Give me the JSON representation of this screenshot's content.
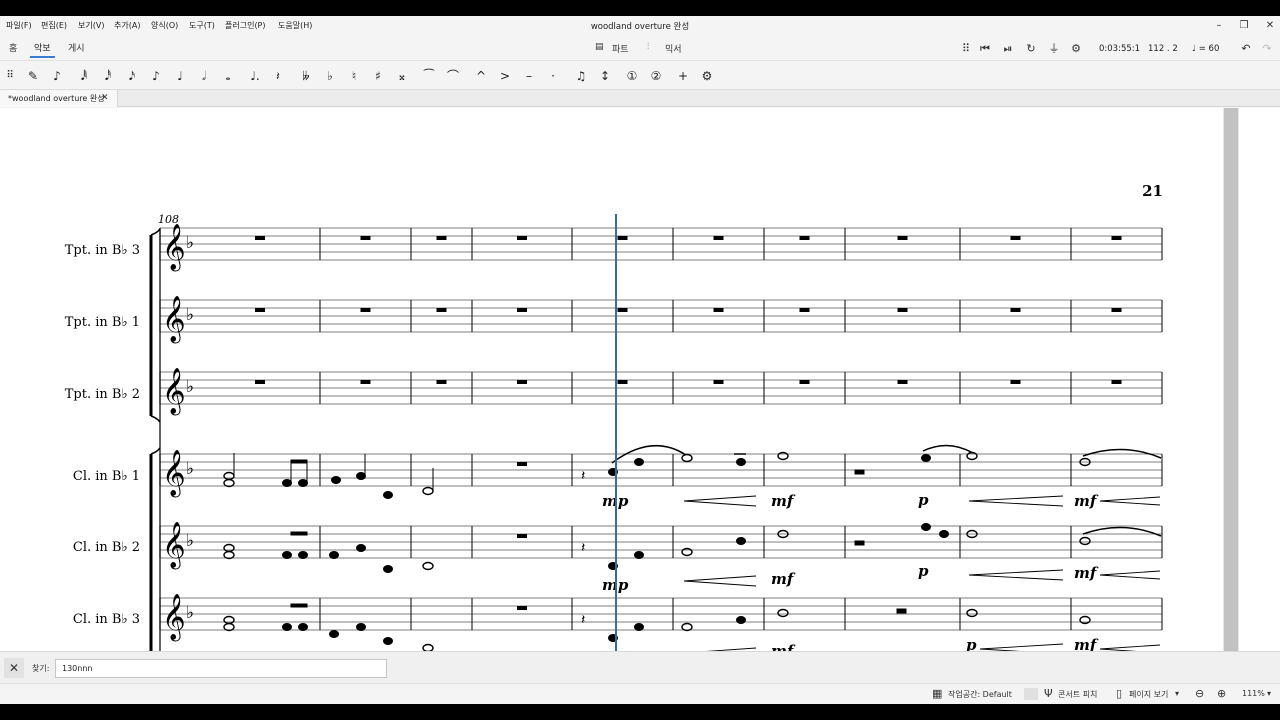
{
  "window": {
    "title": "woodland overture 완성"
  },
  "menu": [
    "파일(F)",
    "편집(E)",
    "보기(V)",
    "추가(A)",
    "양식(O)",
    "도구(T)",
    "플러그인(P)",
    "도움말(H)"
  ],
  "top_tabs": {
    "home": "홈",
    "score": "악보",
    "publish": "게시"
  },
  "center_tabs": {
    "parts": "파트",
    "mixer": "믹서"
  },
  "playback": {
    "time": "0:03:55:1",
    "position": "112 . 2",
    "tempo": "♩ = 60"
  },
  "document_tab": {
    "name": "*woodland overture 완성"
  },
  "score": {
    "page_number": "21",
    "measure_number": "108",
    "instruments": [
      "Tpt. in B♭ 3",
      "Tpt. in B♭ 1",
      "Tpt. in B♭ 2",
      "Cl. in B♭ 1",
      "Cl. in B♭ 2",
      "Cl. in B♭ 3"
    ],
    "dynamics": {
      "mp": "mp",
      "mf": "mf",
      "p": "p"
    }
  },
  "find": {
    "label": "찾기:",
    "value": "130nnn"
  },
  "status": {
    "workspace": "작업공간: Default",
    "concert_pitch": "콘서트 피치",
    "page_view": "페이지 보기",
    "zoom": "111%"
  },
  "colors": {
    "accent": "#3b7bd4",
    "playhead": "#2f6f99",
    "scroll_thumb": "#c2c2c2"
  }
}
